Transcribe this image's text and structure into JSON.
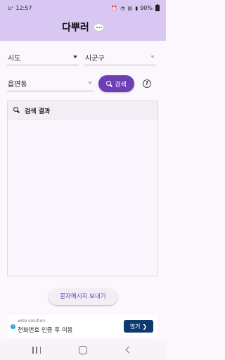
{
  "status_bar": {
    "carrier": "U⁺",
    "time": "12:57",
    "icons": [
      "alarm-icon",
      "wifi-icon",
      "lte-icon",
      "signal-icon"
    ],
    "battery": "90%"
  },
  "app": {
    "title": "다뿌러",
    "logo_icon": "chat-bubble-icon",
    "brand_color": "#d8c7f3",
    "accent_color": "#6c3fb5"
  },
  "filters": {
    "sido": {
      "label": "시도"
    },
    "sigungu": {
      "label": "시군구"
    },
    "eupmyeondong": {
      "label": "읍면동"
    }
  },
  "search_button": {
    "label": "검색",
    "icon": "search-icon"
  },
  "help": {
    "label": "?",
    "icon": "help-icon"
  },
  "results": {
    "title": "검색 결과",
    "icon": "search-icon",
    "items": []
  },
  "message_button": {
    "label": "문자메시지 보내기"
  },
  "ad": {
    "info_label": "i",
    "sponsor": "wise solution",
    "headline": "전화번호 인증 후 이용",
    "cta": "열기",
    "cta_icon": "chevron-right-icon"
  },
  "nav_bar": [
    "recent-apps-icon",
    "home-icon",
    "back-icon"
  ]
}
